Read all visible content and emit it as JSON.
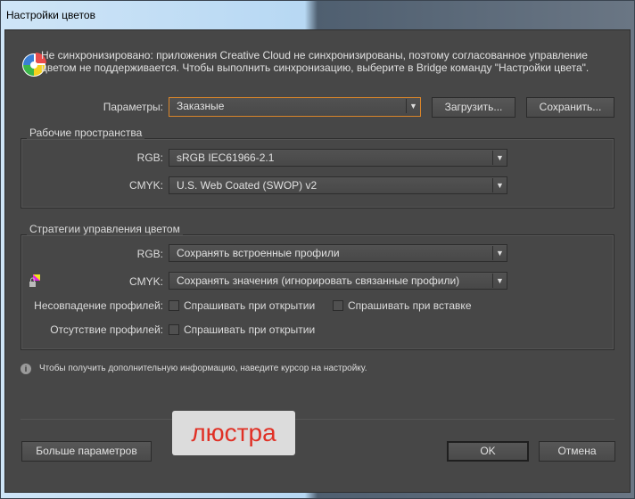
{
  "window": {
    "title": "Настройки цветов"
  },
  "message": "Не синхронизировано: приложения Creative Cloud не синхронизированы, поэтому согласованное управление цветом не поддерживается. Чтобы выполнить синхронизацию, выберите в Bridge команду \"Настройки цвета\".",
  "params": {
    "label": "Параметры:",
    "value": "Заказные",
    "load": "Загрузить...",
    "save": "Сохранить..."
  },
  "workspaces": {
    "title": "Рабочие пространства",
    "rgb_label": "RGB:",
    "rgb_value": "sRGB IEC61966-2.1",
    "cmyk_label": "CMYK:",
    "cmyk_value": "U.S. Web Coated (SWOP) v2"
  },
  "policies": {
    "title": "Стратегии управления цветом",
    "rgb_label": "RGB:",
    "rgb_value": "Сохранять встроенные профили",
    "cmyk_label": "CMYK:",
    "cmyk_value": "Сохранять значения (игнорировать связанные профили)",
    "mismatch_label": "Несовпадение профилей:",
    "mismatch_open": "Спрашивать при открытии",
    "mismatch_paste": "Спрашивать при вставке",
    "missing_label": "Отсутствие профилей:",
    "missing_open": "Спрашивать при открытии"
  },
  "info": "Чтобы получить дополнительную информацию, наведите курсор на настройку.",
  "overlay": "люстра",
  "buttons": {
    "more": "Больше параметров",
    "ok": "OK",
    "cancel": "Отмена"
  }
}
